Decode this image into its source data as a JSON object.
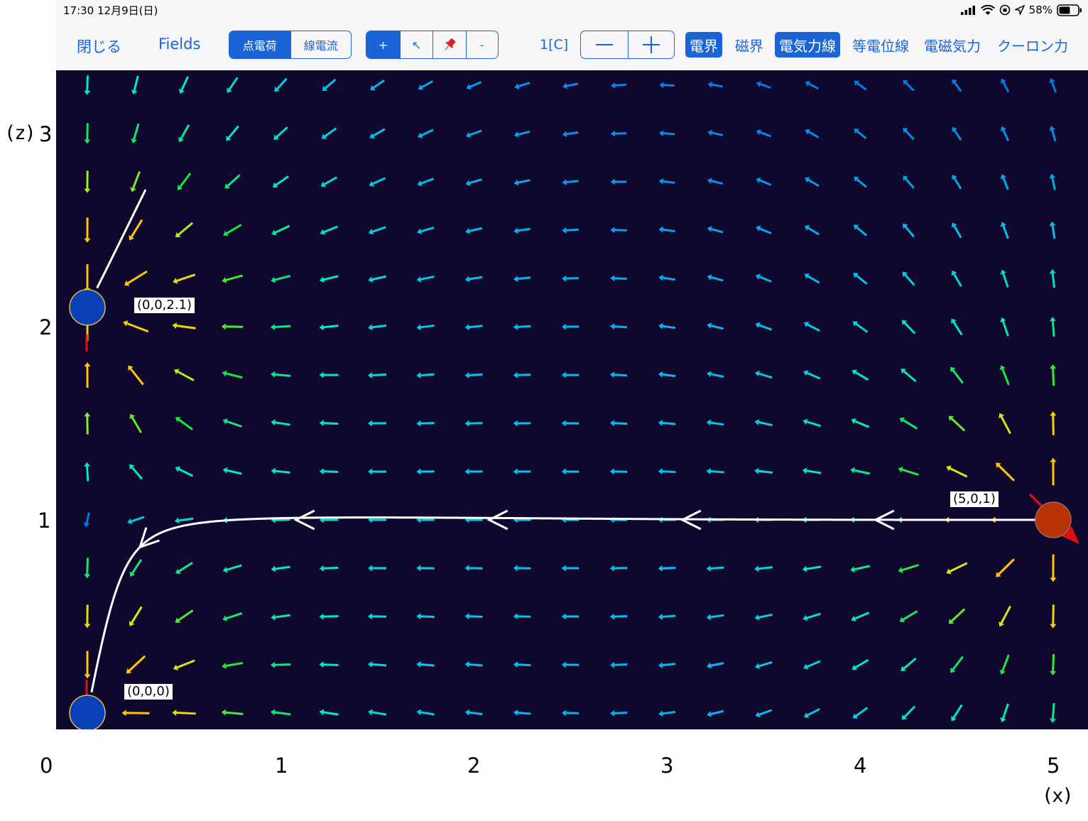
{
  "status_bar": {
    "time_date": "17:30   12月9日(日)",
    "battery": "58%"
  },
  "toolbar": {
    "close_label": "閉じる",
    "fields_label": "Fields",
    "source_mode": [
      {
        "label": "点電荷",
        "active": true
      },
      {
        "label": "線電流",
        "active": false
      }
    ],
    "tools": [
      {
        "label": "+",
        "icon": "add",
        "active": true
      },
      {
        "label": "↖",
        "icon": "pointer-arrow",
        "active": false
      },
      {
        "label": "📌",
        "icon": "pin",
        "active": false
      },
      {
        "label": "-",
        "icon": "remove",
        "active": false
      }
    ],
    "charge_value": "1[C]",
    "decrement_label": "—",
    "increment_label": "+",
    "display_toggles": [
      {
        "label": "電界",
        "active": true
      },
      {
        "label": "磁界",
        "active": false
      },
      {
        "label": "電気力線",
        "active": true
      },
      {
        "label": "等電位線",
        "active": false
      },
      {
        "label": "電磁気力",
        "active": false
      },
      {
        "label": "クーロン力",
        "active": false
      }
    ]
  },
  "plot": {
    "background": "#10072e",
    "x_axis_name": "(x)",
    "z_axis_name": "(z)",
    "x_ticks": [
      "0",
      "1",
      "2",
      "3",
      "4",
      "5"
    ],
    "z_ticks": [
      "1",
      "2",
      "3"
    ],
    "charges": [
      {
        "x": 0,
        "z": 2.1,
        "sign": "negative",
        "color": "#0a3fb8",
        "label": "(0,0,2.1)"
      },
      {
        "x": 0,
        "z": 0,
        "sign": "negative",
        "color": "#0a3fb8",
        "label": "(0,0,0)"
      },
      {
        "x": 5,
        "z": 1,
        "sign": "positive",
        "color": "#b83208",
        "label": "(5,0,1)"
      }
    ],
    "field_line_color": "#ffffff"
  }
}
